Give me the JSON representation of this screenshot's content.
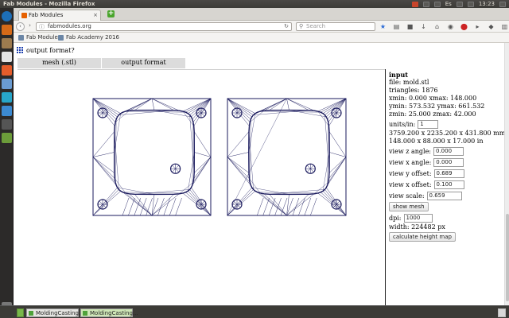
{
  "window": {
    "title": "Fab Modules - Mozilla Firefox",
    "clock": "13:23"
  },
  "tray": {
    "icons": [
      "battery-icon",
      "wifi-icon",
      "keyboard-layout-icon",
      "mail-icon",
      "volume-icon",
      "clock-icon",
      "settings-icon"
    ],
    "keyboard_label": "Es"
  },
  "browser": {
    "tab_title": "Fab Modules",
    "url": "fabmodules.org",
    "search_placeholder": "Search",
    "bookmarks": [
      "Fab Modules",
      "Fab Academy 2016"
    ]
  },
  "page": {
    "heading": "output format?",
    "tabs": [
      "mesh (.stl)",
      "output format"
    ]
  },
  "panel": {
    "title": "input",
    "file": "file: mold.stl",
    "triangles": "triangles: 1876",
    "xrange": "xmin: 0.000 xmax: 148.000",
    "yrange": "ymin: 573.532 ymax: 661.532",
    "zrange": "zmin: 25.000 zmax: 42.000",
    "units_label": "units/in:",
    "units_value": "1",
    "size_mm": "3759.200 x 2235.200 x 431.800 mm",
    "size_in": "148.000 x 88.000 x 17.000 in",
    "view_z_label": "view z angle:",
    "view_z_value": "0.000",
    "view_x_label": "view x angle:",
    "view_x_value": "0.000",
    "view_yoff_label": "view y offset:",
    "view_yoff_value": "0.689",
    "view_xoff_label": "view x offset:",
    "view_xoff_value": "0.100",
    "view_scale_label": "view scale:",
    "view_scale_value": "0.659",
    "show_mesh_label": "show mesh",
    "dpi_label": "dpi:",
    "dpi_value": "1000",
    "width": "width: 224482 px",
    "calc_label": "calculate height map"
  },
  "taskbar": {
    "tasks": [
      "MoldingCasting...",
      "MoldingCasting..."
    ]
  },
  "colors": {
    "mesh_stroke": "#1b1b5e",
    "accent_blue": "#1c3fae"
  }
}
